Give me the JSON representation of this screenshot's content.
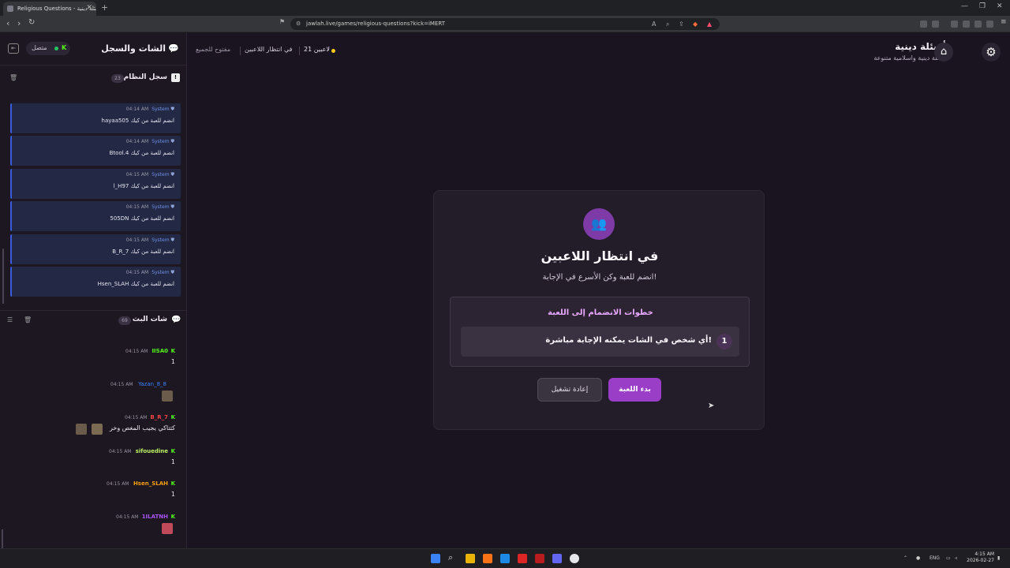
{
  "browser": {
    "tab_title": "Religious Questions - أسئلة دينية",
    "url": "jawlah.live/games/religious-questions?kick=iMERT"
  },
  "sidebar": {
    "title": "الشات والسجل",
    "connection_status": "متصل",
    "kick_letter": "K",
    "system_log": {
      "title": "سجل النظام",
      "count": "23",
      "items": [
        {
          "author": "System",
          "time": "04:14 AM",
          "message": "hayaa505 انضم للعبة من كيك"
        },
        {
          "author": "System",
          "time": "04:14 AM",
          "message": "Btool.4 انضم للعبة من كيك"
        },
        {
          "author": "System",
          "time": "04:15 AM",
          "message": "l_H97 انضم للعبة من كيك"
        },
        {
          "author": "System",
          "time": "04:15 AM",
          "message": "505DN انضم للعبة من كيك"
        },
        {
          "author": "System",
          "time": "04:15 AM",
          "message": "B_R_7 انضم للعبة من كيك"
        },
        {
          "author": "System",
          "time": "04:15 AM",
          "message": "Hsen_SLAH انضم للعبة من كيك"
        }
      ]
    },
    "stream_chat": {
      "title": "شات البث",
      "count": "69",
      "messages": [
        {
          "user": "IISA0",
          "color": "#53fc18",
          "kick": true,
          "time": "04:15 AM",
          "text": "1"
        },
        {
          "user": "Yazan_8_8",
          "color": "#3b82f6",
          "kick": false,
          "time": "04:15 AM",
          "text": ""
        },
        {
          "user": "B_R_7",
          "color": "#ef4444",
          "kick": true,
          "time": "04:15 AM",
          "text": "كتتاكي يجيب المغص وخر"
        },
        {
          "user": "sifouedine",
          "color": "#bef264",
          "kick": true,
          "time": "04:15 AM",
          "text": "1"
        },
        {
          "user": "Hsen_SLAH",
          "color": "#f59e0b",
          "kick": true,
          "time": "04:15 AM",
          "text": "1"
        },
        {
          "user": "1ILATNH",
          "color": "#a855f7",
          "kick": true,
          "time": "04:15 AM",
          "text": ""
        }
      ]
    }
  },
  "header": {
    "app_title": "أسئلة دينية",
    "app_subtitle": "أسئلة دينية واسلامية متنوعة",
    "players_count": "21 لاعبين",
    "state": "في انتظار اللاعبين",
    "access": "مفتوح للجميع"
  },
  "card": {
    "title": "في انتظار اللاعبين",
    "subtitle": "انضم للعبة وكن الأسرع في الإجابة!",
    "steps_title": "خطوات الانضمام إلى اللعبة",
    "steps": [
      {
        "number": "1",
        "text": "أي شخص في الشات يمكنه الإجابة مباشرة!"
      }
    ],
    "restart_label": "إعادة تشغيل",
    "start_label": "بدء اللعبة"
  },
  "taskbar": {
    "lang": "ENG",
    "time": "4:15 AM",
    "date": "2026-02-27"
  },
  "colors": {
    "accent": "#9b3ec7",
    "kick_green": "#53fc18",
    "background": "#1a1420"
  }
}
